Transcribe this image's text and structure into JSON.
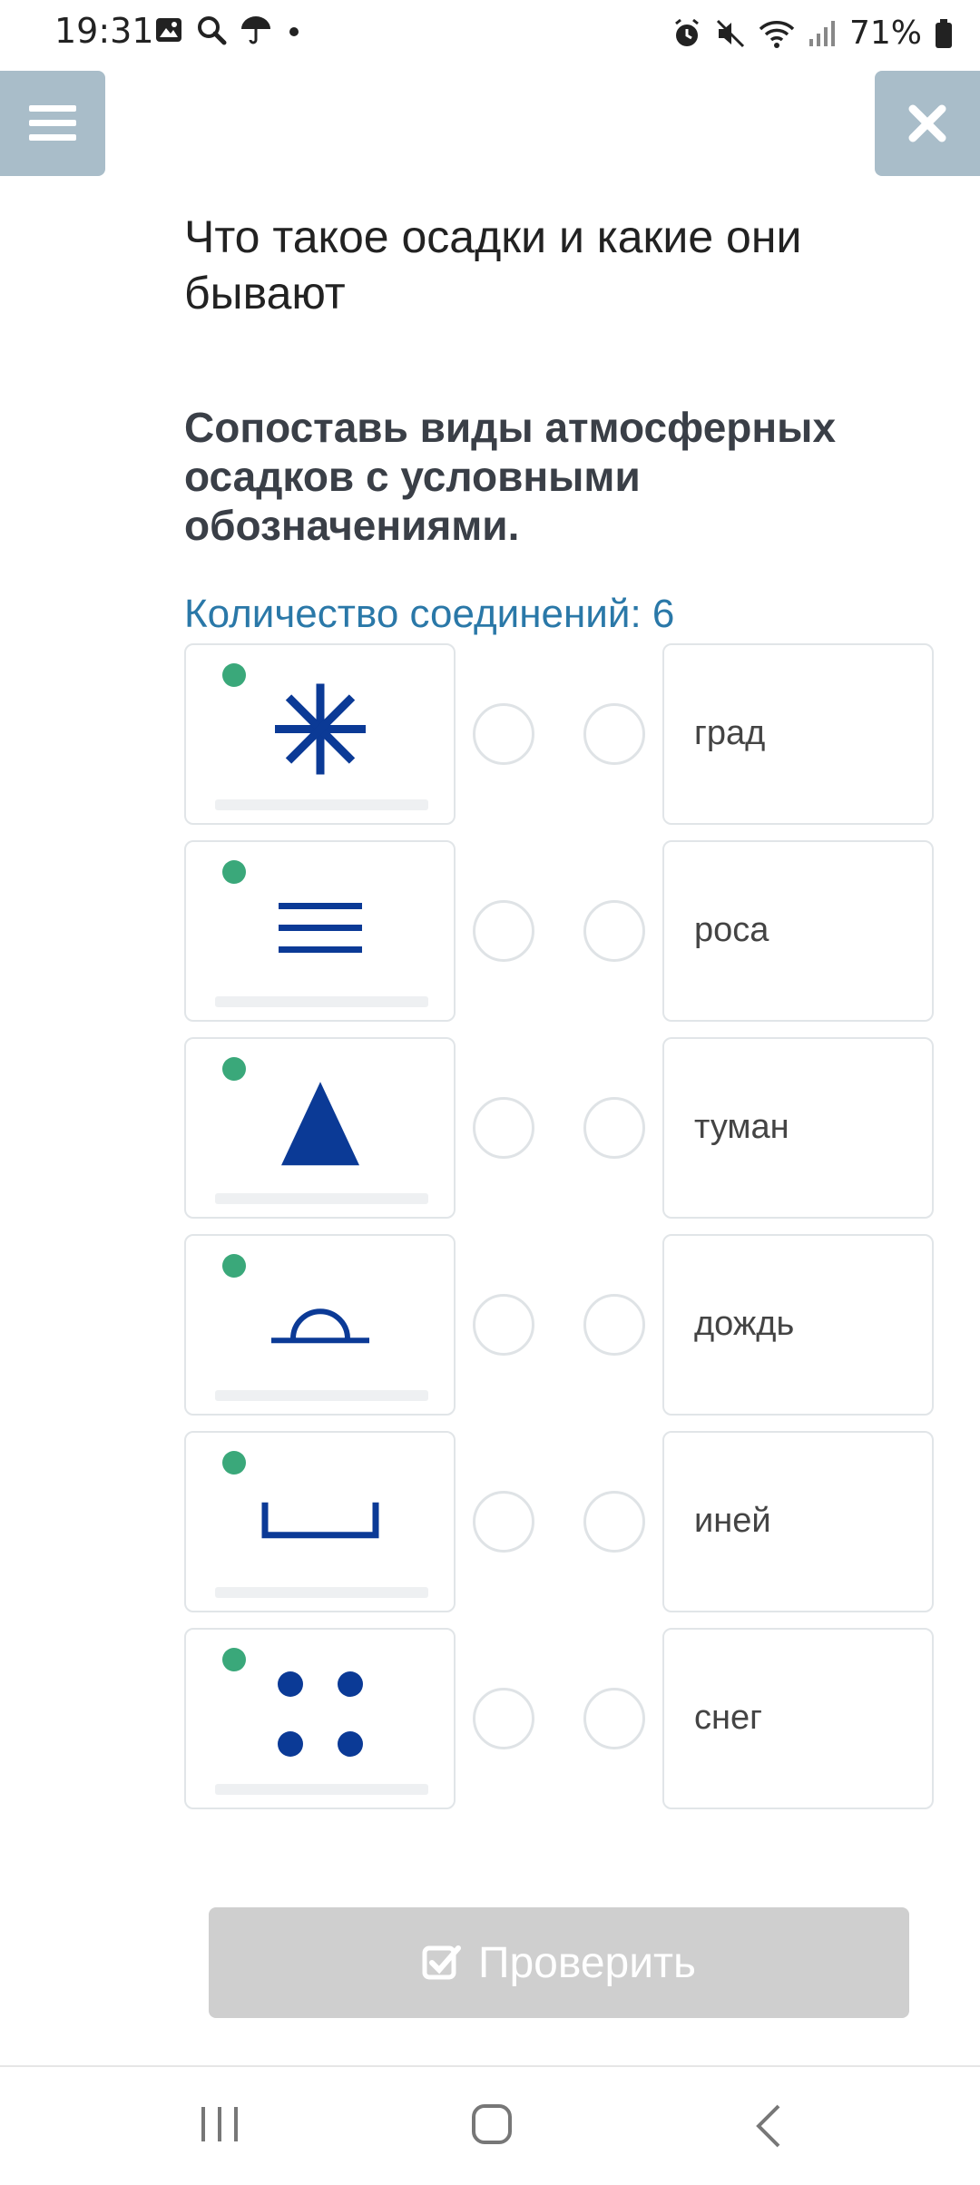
{
  "status_bar": {
    "time": "19:31",
    "battery_text": "71%",
    "left_icons": [
      "gallery-icon",
      "search-icon",
      "umbrella-icon",
      "dot-icon"
    ],
    "right_icons": [
      "alarm-icon",
      "mute-icon",
      "wifi-icon",
      "signal-icon",
      "battery-icon"
    ]
  },
  "header": {
    "menu_icon": "hamburger-icon",
    "close_icon": "close-icon"
  },
  "lesson": {
    "title": "Что такое осадки и какие они бывают",
    "task": "Сопоставь виды атмосферных осадков с условными обозначениями.",
    "connections": "Количество соединений: 6"
  },
  "symbols": [
    {
      "icon": "snowflake-asterisk-icon"
    },
    {
      "icon": "three-lines-fog-icon"
    },
    {
      "icon": "triangle-hail-icon"
    },
    {
      "icon": "half-circle-dew-icon"
    },
    {
      "icon": "bracket-frost-icon"
    },
    {
      "icon": "four-dots-rain-icon"
    }
  ],
  "words": [
    "град",
    "роса",
    "туман",
    "дождь",
    "иней",
    "снег"
  ],
  "check_button": {
    "label": "Проверить",
    "icon": "checkbox-icon"
  },
  "colors": {
    "accent_blue": "#0b3a96",
    "link_blue": "#2a78a8",
    "header_button": "#a9bdc9",
    "disabled_button": "#cfcfcf",
    "badge_green": "#3aa87a"
  },
  "nav": {
    "icons": [
      "recents-icon",
      "home-icon",
      "back-icon"
    ]
  }
}
